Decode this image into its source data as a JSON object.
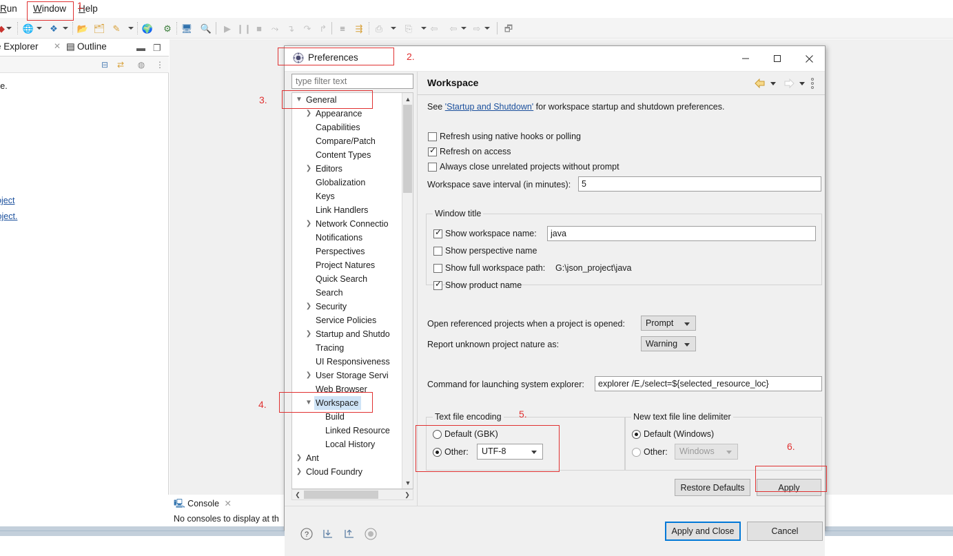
{
  "menubar": {
    "items": [
      {
        "label": "Run",
        "mnemonic": "R"
      },
      {
        "label": "Window",
        "mnemonic": "W"
      },
      {
        "label": "Help",
        "mnemonic": "H"
      }
    ]
  },
  "views": {
    "explorer_tab": "e Explorer",
    "outline_tab": "Outline",
    "body_fragment": "ce.",
    "link1": "nt project",
    "link2": "o project."
  },
  "console": {
    "tab_label": "Console",
    "empty_message": "No consoles to display at th"
  },
  "dialog": {
    "title": "Preferences",
    "icon": "preferences-icon",
    "window_buttons": {
      "minimize": "—",
      "maximize": "☐",
      "close": "✕"
    },
    "filter_placeholder": "type filter text",
    "tree": [
      {
        "label": "General",
        "indent": 0,
        "twisty": "expanded",
        "selected": false
      },
      {
        "label": "Appearance",
        "indent": 1,
        "twisty": "collapsed",
        "selected": false
      },
      {
        "label": "Capabilities",
        "indent": 1,
        "twisty": "none",
        "selected": false
      },
      {
        "label": "Compare/Patch",
        "indent": 1,
        "twisty": "none",
        "selected": false
      },
      {
        "label": "Content Types",
        "indent": 1,
        "twisty": "none",
        "selected": false
      },
      {
        "label": "Editors",
        "indent": 1,
        "twisty": "collapsed",
        "selected": false
      },
      {
        "label": "Globalization",
        "indent": 1,
        "twisty": "none",
        "selected": false
      },
      {
        "label": "Keys",
        "indent": 1,
        "twisty": "none",
        "selected": false
      },
      {
        "label": "Link Handlers",
        "indent": 1,
        "twisty": "none",
        "selected": false
      },
      {
        "label": "Network Connectio",
        "indent": 1,
        "twisty": "collapsed",
        "selected": false
      },
      {
        "label": "Notifications",
        "indent": 1,
        "twisty": "none",
        "selected": false
      },
      {
        "label": "Perspectives",
        "indent": 1,
        "twisty": "none",
        "selected": false
      },
      {
        "label": "Project Natures",
        "indent": 1,
        "twisty": "none",
        "selected": false
      },
      {
        "label": "Quick Search",
        "indent": 1,
        "twisty": "none",
        "selected": false
      },
      {
        "label": "Search",
        "indent": 1,
        "twisty": "none",
        "selected": false
      },
      {
        "label": "Security",
        "indent": 1,
        "twisty": "collapsed",
        "selected": false
      },
      {
        "label": "Service Policies",
        "indent": 1,
        "twisty": "none",
        "selected": false
      },
      {
        "label": "Startup and Shutdo",
        "indent": 1,
        "twisty": "collapsed",
        "selected": false
      },
      {
        "label": "Tracing",
        "indent": 1,
        "twisty": "none",
        "selected": false
      },
      {
        "label": "UI Responsiveness",
        "indent": 1,
        "twisty": "none",
        "selected": false
      },
      {
        "label": "User Storage Servi",
        "indent": 1,
        "twisty": "collapsed",
        "selected": false
      },
      {
        "label": "Web Browser",
        "indent": 1,
        "twisty": "none",
        "selected": false
      },
      {
        "label": "Workspace",
        "indent": 1,
        "twisty": "expanded",
        "selected": true
      },
      {
        "label": "Build",
        "indent": 2,
        "twisty": "none",
        "selected": false
      },
      {
        "label": "Linked Resource",
        "indent": 2,
        "twisty": "none",
        "selected": false
      },
      {
        "label": "Local History",
        "indent": 2,
        "twisty": "none",
        "selected": false
      },
      {
        "label": "Ant",
        "indent": 0,
        "twisty": "collapsed",
        "selected": false
      },
      {
        "label": "Cloud Foundry",
        "indent": 0,
        "twisty": "collapsed",
        "selected": false
      }
    ],
    "pane": {
      "title": "Workspace",
      "nav_back": "back-arrow-icon",
      "nav_forward": "forward-arrow-icon",
      "menu": "view-menu-icon",
      "intro_prefix": "See ",
      "intro_link": "'Startup and Shutdown'",
      "intro_suffix": " for workspace startup and shutdown preferences.",
      "checkboxes": [
        {
          "label": "Refresh using native hooks or polling",
          "checked": false,
          "mnemonic": "R"
        },
        {
          "label": "Refresh on access",
          "checked": true,
          "mnemonic": "s"
        },
        {
          "label": "Always close unrelated projects without prompt",
          "checked": false,
          "mnemonic": "c"
        }
      ],
      "save_interval_label": "Workspace save interval (in minutes):",
      "save_interval_value": "5",
      "window_title_group": {
        "label": "Window title",
        "show_workspace_name_label": "Show workspace name:",
        "show_workspace_name_checked": true,
        "workspace_name_value": "java",
        "show_perspective_name_label": "Show perspective name",
        "show_perspective_name_checked": false,
        "show_full_path_label": "Show full workspace path:",
        "show_full_path_checked": false,
        "full_path_value": "G:\\json_project\\java",
        "show_product_name_label": "Show product name",
        "show_product_name_checked": true
      },
      "open_referenced_label": "Open referenced projects when a project is opened:",
      "open_referenced_value": "Prompt",
      "report_nature_label": "Report unknown project nature as:",
      "report_nature_value": "Warning",
      "command_label": "Command for launching system explorer:",
      "command_value": "explorer /E,/select=${selected_resource_loc}",
      "encoding_group": {
        "label": "Text file encoding",
        "default_label": "Default (GBK)",
        "default_selected": false,
        "other_label": "Other:",
        "other_selected": true,
        "other_value": "UTF-8"
      },
      "delimiter_group": {
        "label": "New text file line delimiter",
        "default_label": "Default (Windows)",
        "default_selected": true,
        "other_label": "Other:",
        "other_selected": false,
        "other_value": "Windows",
        "other_disabled": true
      },
      "restore_defaults_label": "Restore Defaults",
      "apply_label": "Apply"
    },
    "footer": {
      "help_icon": "help-question-icon",
      "import_icon": "import-icon",
      "export_icon": "export-icon",
      "record_icon": "record-icon",
      "apply_and_close_label": "Apply and Close",
      "cancel_label": "Cancel"
    }
  },
  "annotations": {
    "step1": "1.",
    "step2": "2.",
    "step3": "3.",
    "step4": "4.",
    "step5": "5.",
    "step6": "6.",
    "color": "#e03030"
  }
}
